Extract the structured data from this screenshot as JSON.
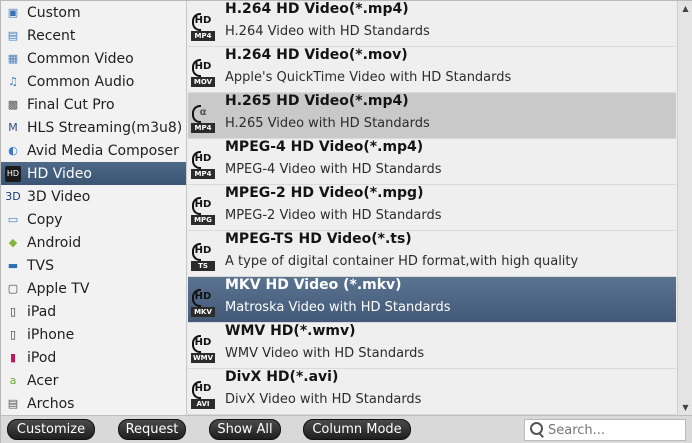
{
  "categories": [
    {
      "label": "Custom",
      "icon": "custom-icon",
      "glyph": "▣",
      "color": "#3a6fb0"
    },
    {
      "label": "Recent",
      "icon": "recent-icon",
      "glyph": "▤",
      "color": "#3f7fbf"
    },
    {
      "label": "Common Video",
      "icon": "video-icon",
      "glyph": "▦",
      "color": "#4a7dbe"
    },
    {
      "label": "Common Audio",
      "icon": "audio-note-icon",
      "glyph": "♫",
      "color": "#3c79c9"
    },
    {
      "label": "Final Cut Pro",
      "icon": "clapper-icon",
      "glyph": "▩",
      "color": "#555555"
    },
    {
      "label": "HLS Streaming(m3u8)",
      "icon": "m3u8-icon",
      "glyph": "M",
      "color": "#2d4f79"
    },
    {
      "label": "Avid Media Composer",
      "icon": "avid-icon",
      "glyph": "◐",
      "color": "#3a79c6"
    },
    {
      "label": "HD Video",
      "icon": "hd-icon",
      "glyph": "HD",
      "color": "#1e1e1e"
    },
    {
      "label": "3D Video",
      "icon": "3d-icon",
      "glyph": "3D",
      "color": "#1b3c73"
    },
    {
      "label": "Copy",
      "icon": "copy-icon",
      "glyph": "▭",
      "color": "#3d7fc4"
    },
    {
      "label": "Android",
      "icon": "android-icon",
      "glyph": "◆",
      "color": "#86b33b"
    },
    {
      "label": "TVS",
      "icon": "tv-icon",
      "glyph": "▬",
      "color": "#2f6fb8"
    },
    {
      "label": "Apple TV",
      "icon": "apple-tv-icon",
      "glyph": "▢",
      "color": "#444444"
    },
    {
      "label": "iPad",
      "icon": "ipad-icon",
      "glyph": "▯",
      "color": "#333333"
    },
    {
      "label": "iPhone",
      "icon": "iphone-icon",
      "glyph": "▯",
      "color": "#333333"
    },
    {
      "label": "iPod",
      "icon": "ipod-icon",
      "glyph": "▮",
      "color": "#c2185b"
    },
    {
      "label": "Acer",
      "icon": "acer-icon",
      "glyph": "a",
      "color": "#6aa33a"
    },
    {
      "label": "Archos",
      "icon": "archos-icon",
      "glyph": "▤",
      "color": "#555555"
    }
  ],
  "selected_category": "HD Video",
  "formats": [
    {
      "title": "H.264 HD Video(*.mp4)",
      "desc": "H.264 Video with HD Standards",
      "tag": "MP4",
      "hd": "HD"
    },
    {
      "title": "H.264 HD Video(*.mov)",
      "desc": "Apple's QuickTime Video with HD Standards",
      "tag": "MOV",
      "hd": "HD"
    },
    {
      "title": "H.265 HD Video(*.mp4)",
      "desc": "H.265 Video with HD Standards",
      "tag": "MP4",
      "hd": "α"
    },
    {
      "title": "MPEG-4 HD Video(*.mp4)",
      "desc": "MPEG-4 Video with HD Standards",
      "tag": "MP4",
      "hd": "HD"
    },
    {
      "title": "MPEG-2 HD Video(*.mpg)",
      "desc": "MPEG-2 Video with HD Standards",
      "tag": "MPG",
      "hd": "HD"
    },
    {
      "title": "MPEG-TS HD Video(*.ts)",
      "desc": "A type of digital container HD format,with high quality",
      "tag": "TS",
      "hd": "HD"
    },
    {
      "title": "MKV HD Video (*.mkv)",
      "desc": "Matroska Video with HD Standards",
      "tag": "MKV",
      "hd": "HD"
    },
    {
      "title": "WMV HD(*.wmv)",
      "desc": "WMV Video with HD Standards",
      "tag": "WMV",
      "hd": "HD"
    },
    {
      "title": "DivX HD(*.avi)",
      "desc": "DivX Video with HD Standards",
      "tag": "AVI",
      "hd": "HD"
    }
  ],
  "hover_format": "H.265 HD Video(*.mp4)",
  "selected_format": "MKV HD Video (*.mkv)",
  "buttons": {
    "customize": "Customize",
    "request": "Request",
    "show_all": "Show All",
    "column_mode": "Column Mode"
  },
  "search": {
    "placeholder": "Search..."
  }
}
